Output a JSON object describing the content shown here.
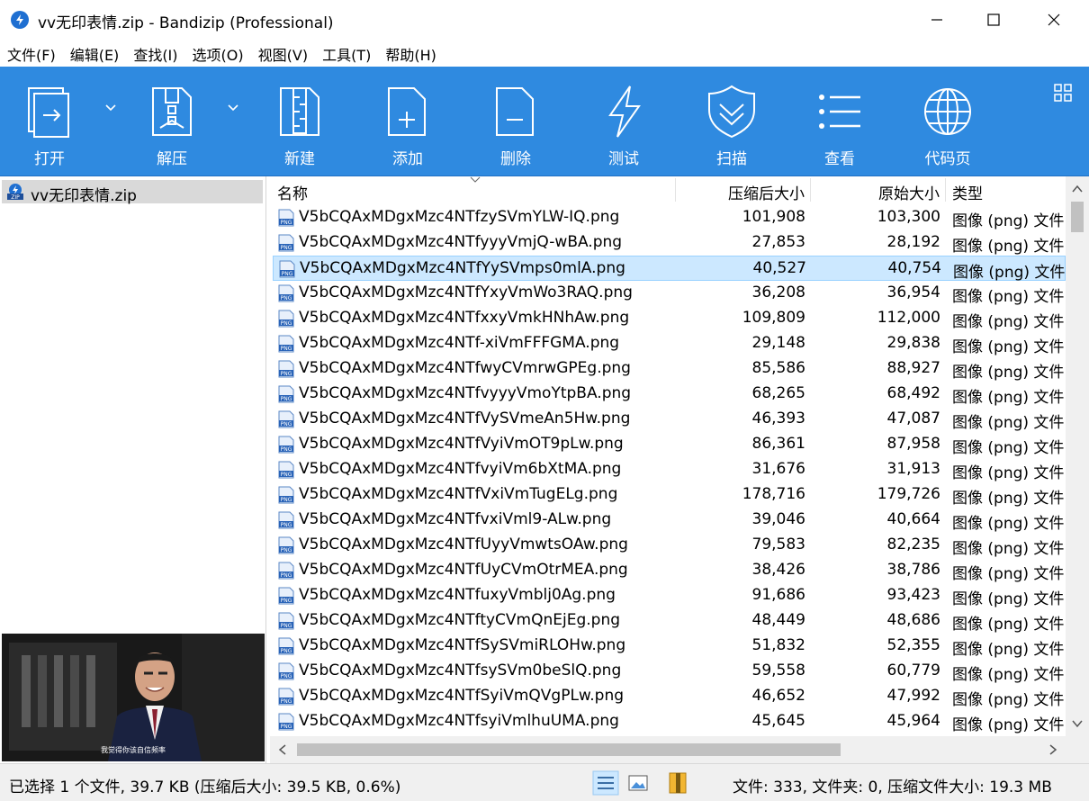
{
  "window": {
    "title": "vv无印表情.zip - Bandizip (Professional)"
  },
  "menu": [
    "文件(F)",
    "编辑(E)",
    "查找(I)",
    "选项(O)",
    "视图(V)",
    "工具(T)",
    "帮助(H)"
  ],
  "toolbar": {
    "open": "打开",
    "extract": "解压",
    "new": "新建",
    "add": "添加",
    "delete": "删除",
    "test": "测试",
    "scan": "扫描",
    "view": "查看",
    "codepage": "代码页"
  },
  "tree": {
    "archive": "vv无印表情.zip"
  },
  "preview": {
    "caption": "我觉得你该自信频率"
  },
  "columns": {
    "name": "名称",
    "compressed": "压缩后大小",
    "original": "原始大小",
    "type": "类型"
  },
  "files": [
    {
      "name": "V5bCQAxMDgxMzc4NTfzySVmYLW-IQ.png",
      "compressed": "101,908",
      "original": "103,300",
      "type": "图像 (png) 文件"
    },
    {
      "name": "V5bCQAxMDgxMzc4NTfyyyVmjQ-wBA.png",
      "compressed": "27,853",
      "original": "28,192",
      "type": "图像 (png) 文件"
    },
    {
      "name": "V5bCQAxMDgxMzc4NTfYySVmps0mlA.png",
      "compressed": "40,527",
      "original": "40,754",
      "type": "图像 (png) 文件",
      "selected": true
    },
    {
      "name": "V5bCQAxMDgxMzc4NTfYxyVmWo3RAQ.png",
      "compressed": "36,208",
      "original": "36,954",
      "type": "图像 (png) 文件"
    },
    {
      "name": "V5bCQAxMDgxMzc4NTfxxyVmkHNhAw.png",
      "compressed": "109,809",
      "original": "112,000",
      "type": "图像 (png) 文件"
    },
    {
      "name": "V5bCQAxMDgxMzc4NTf-xiVmFFFGMA.png",
      "compressed": "29,148",
      "original": "29,838",
      "type": "图像 (png) 文件"
    },
    {
      "name": "V5bCQAxMDgxMzc4NTfwyCVmrwGPEg.png",
      "compressed": "85,586",
      "original": "88,927",
      "type": "图像 (png) 文件"
    },
    {
      "name": "V5bCQAxMDgxMzc4NTfvyyyVmoYtpBA.png",
      "compressed": "68,265",
      "original": "68,492",
      "type": "图像 (png) 文件"
    },
    {
      "name": "V5bCQAxMDgxMzc4NTfVySVmeAn5Hw.png",
      "compressed": "46,393",
      "original": "47,087",
      "type": "图像 (png) 文件"
    },
    {
      "name": "V5bCQAxMDgxMzc4NTfVyiVmOT9pLw.png",
      "compressed": "86,361",
      "original": "87,958",
      "type": "图像 (png) 文件"
    },
    {
      "name": "V5bCQAxMDgxMzc4NTfvyiVm6bXtMA.png",
      "compressed": "31,676",
      "original": "31,913",
      "type": "图像 (png) 文件"
    },
    {
      "name": "V5bCQAxMDgxMzc4NTfVxiVmTugELg.png",
      "compressed": "178,716",
      "original": "179,726",
      "type": "图像 (png) 文件"
    },
    {
      "name": "V5bCQAxMDgxMzc4NTfvxiVml9-ALw.png",
      "compressed": "39,046",
      "original": "40,664",
      "type": "图像 (png) 文件"
    },
    {
      "name": "V5bCQAxMDgxMzc4NTfUyyVmwtsOAw.png",
      "compressed": "79,583",
      "original": "82,235",
      "type": "图像 (png) 文件"
    },
    {
      "name": "V5bCQAxMDgxMzc4NTfUyCVmOtrMEA.png",
      "compressed": "38,426",
      "original": "38,786",
      "type": "图像 (png) 文件"
    },
    {
      "name": "V5bCQAxMDgxMzc4NTfuxyVmblj0Ag.png",
      "compressed": "91,686",
      "original": "93,423",
      "type": "图像 (png) 文件"
    },
    {
      "name": "V5bCQAxMDgxMzc4NTftyCVmQnEjEg.png",
      "compressed": "48,449",
      "original": "48,686",
      "type": "图像 (png) 文件"
    },
    {
      "name": "V5bCQAxMDgxMzc4NTfSySVmiRLOHw.png",
      "compressed": "51,832",
      "original": "52,355",
      "type": "图像 (png) 文件"
    },
    {
      "name": "V5bCQAxMDgxMzc4NTfsySVm0beSlQ.png",
      "compressed": "59,558",
      "original": "60,779",
      "type": "图像 (png) 文件"
    },
    {
      "name": "V5bCQAxMDgxMzc4NTfSyiVmQVgPLw.png",
      "compressed": "46,652",
      "original": "47,992",
      "type": "图像 (png) 文件"
    },
    {
      "name": "V5bCQAxMDgxMzc4NTfsyiVmlhuUMA.png",
      "compressed": "45,645",
      "original": "45,964",
      "type": "图像 (png) 文件"
    }
  ],
  "status": {
    "left": "已选择 1 个文件, 39.7 KB (压缩后大小: 39.5 KB, 0.6%)",
    "right": "文件: 333, 文件夹: 0, 压缩文件大小: 19.3 MB"
  },
  "colors": {
    "toolbar_bg": "#2f8ae0",
    "selection": "#cce8ff"
  }
}
